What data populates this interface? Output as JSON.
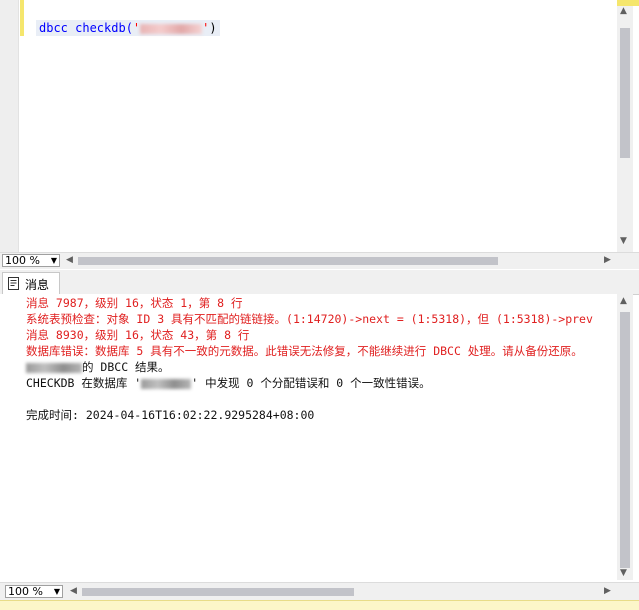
{
  "editor": {
    "code_prefix": "dbcc checkdb(",
    "code_quote_open": "'",
    "code_quote_close": "'",
    "code_suffix": ")",
    "zoom": "100 %"
  },
  "results": {
    "tab_label": "消息",
    "zoom": "100 %",
    "messages": [
      {
        "text": "消息 7987，级别 16，状态 1，第 8 行",
        "type": "error"
      },
      {
        "text": "系统表预检查：对象 ID 3 具有不匹配的链链接。(1:14720)->next = (1:5318)，但 (1:5318)->prev",
        "type": "error"
      },
      {
        "text": "消息 8930，级别 16，状态 43，第 8 行",
        "type": "error"
      },
      {
        "text": "数据库错误：数据库 5 具有不一致的元数据。此错误无法修复，不能继续进行 DBCC 处理。请从备份还原。",
        "type": "error"
      },
      {
        "text": "的 DBCC 结果。",
        "type": "normal"
      },
      {
        "text_prefix": "CHECKDB 在数据库 '",
        "text_suffix": "' 中发现 0 个分配错误和 0 个一致性错误。",
        "type": "normal"
      },
      {
        "text": "完成时间: 2024-04-16T16:02:22.9295284+08:00",
        "type": "normal"
      }
    ]
  },
  "colors": {
    "error": "#e02020",
    "keyword": "#0000ff",
    "string": "#ff0000",
    "change_marker": "#f5e66d"
  },
  "icons": {
    "tab": "messages-icon",
    "dropdown": "chevron-down-icon",
    "scroll_left": "arrow-left-icon",
    "scroll_right": "arrow-right-icon",
    "scroll_up": "arrow-up-icon",
    "scroll_down": "arrow-down-icon"
  }
}
